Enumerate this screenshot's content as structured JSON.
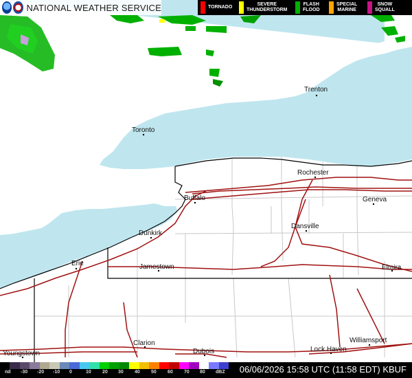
{
  "header": {
    "title": "NATIONAL WEATHER SERVICE",
    "logos": [
      "noaa-logo",
      "nws-logo"
    ]
  },
  "warnings_legend": [
    {
      "label": "TORNADO",
      "color": "#ff0000"
    },
    {
      "label": "SEVERE\nTHUNDERSTORM",
      "color": "#ffff00"
    },
    {
      "label": "FLASH\nFLOOD",
      "color": "#00b000"
    },
    {
      "label": "SPECIAL\nMARINE",
      "color": "#ffa500"
    },
    {
      "label": "SNOW\nSQUALL",
      "color": "#c71585"
    }
  ],
  "cities": [
    {
      "name": "Trenton"
    },
    {
      "name": "Toronto"
    },
    {
      "name": "Rochester"
    },
    {
      "name": "Buffalo"
    },
    {
      "name": "Geneva"
    },
    {
      "name": "Dansville"
    },
    {
      "name": "Dunkirk"
    },
    {
      "name": "Erie"
    },
    {
      "name": "Jamestown"
    },
    {
      "name": "Elmira"
    },
    {
      "name": "Williamsport"
    },
    {
      "name": "Clarion"
    },
    {
      "name": "Dubois"
    },
    {
      "name": "Lock Haven"
    },
    {
      "name": "Youngstown"
    }
  ],
  "radar_legend": {
    "ticks": [
      "nd",
      "-30",
      "-20",
      "-10",
      "0",
      "10",
      "20",
      "30",
      "40",
      "50",
      "60",
      "70",
      "80",
      "dBZ"
    ],
    "colors": [
      "#000000",
      "#3a2a4a",
      "#5a4a6a",
      "#8a7a9a",
      "#b0a890",
      "#c8c8b4",
      "#6a8ab8",
      "#4a6ad8",
      "#48c8f0",
      "#30e0a8",
      "#00d000",
      "#00a000",
      "#008800",
      "#ffff00",
      "#f0c000",
      "#ff8000",
      "#ff0000",
      "#c00000",
      "#ff00ff",
      "#a000c0",
      "#ffffff",
      "#7a7aff",
      "#4040d0"
    ]
  },
  "timestamp": "06/06/2026 15:58 UTC (11:58 EDT) KBUF",
  "colors": {
    "water": "#bfe6ef",
    "county_lines": "#cccccc",
    "state_lines": "#000000",
    "highways": "#a01010"
  }
}
